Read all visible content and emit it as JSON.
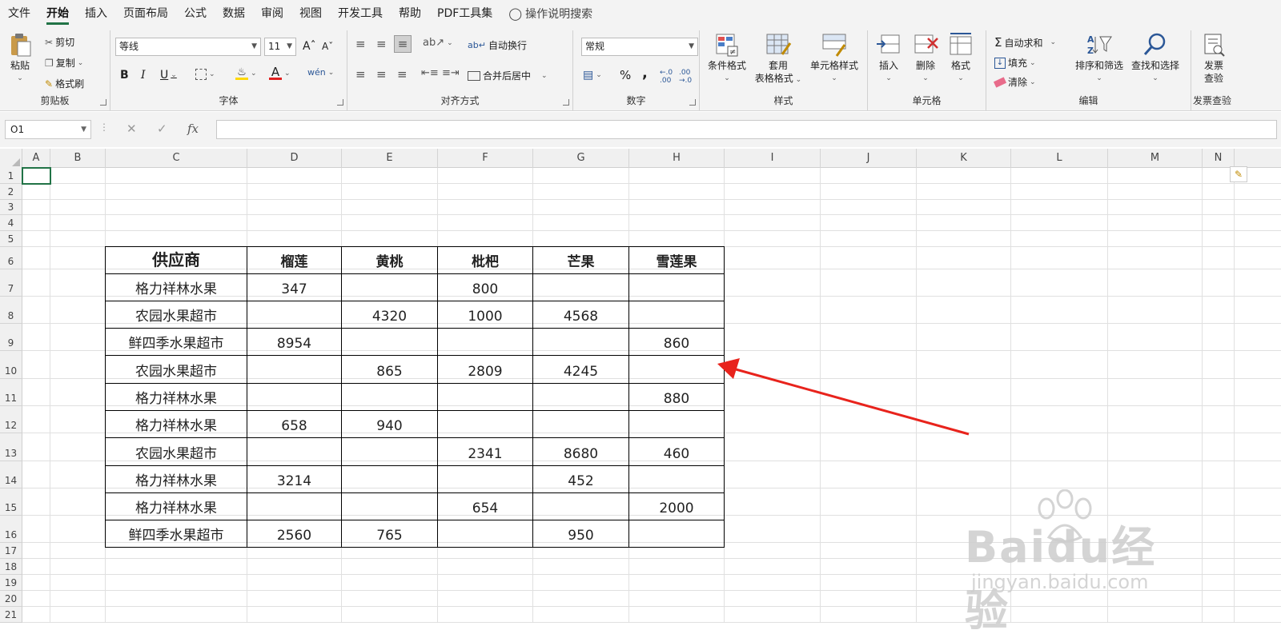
{
  "menu": {
    "items": [
      "文件",
      "开始",
      "插入",
      "页面布局",
      "公式",
      "数据",
      "审阅",
      "视图",
      "开发工具",
      "帮助",
      "PDF工具集"
    ],
    "active_index": 1,
    "search_label": "操作说明搜索"
  },
  "ribbon": {
    "clipboard": {
      "paste": "粘贴",
      "cut": "剪切",
      "copy": "复制",
      "format_painter": "格式刷",
      "label": "剪贴板"
    },
    "font": {
      "font_name": "等线",
      "font_size": "11",
      "bold": "B",
      "italic": "I",
      "underline": "U",
      "label": "字体"
    },
    "alignment": {
      "wrap_text": "自动换行",
      "merge_center": "合并后居中",
      "label": "对齐方式"
    },
    "number": {
      "format": "常规",
      "percent": "%",
      "comma": ",",
      "label": "数字"
    },
    "styles": {
      "conditional": "条件格式",
      "table_format_1": "套用",
      "table_format_2": "表格格式",
      "cell_styles": "单元格样式",
      "label": "样式"
    },
    "cells": {
      "insert": "插入",
      "delete": "删除",
      "format": "格式",
      "label": "单元格"
    },
    "editing": {
      "autosum": "自动求和",
      "fill": "填充",
      "clear": "清除",
      "sort_filter": "排序和筛选",
      "find_select": "查找和选择",
      "label": "编辑"
    },
    "invoice": {
      "check_1": "发票",
      "check_2": "查验",
      "label": "发票查验"
    }
  },
  "formula_bar": {
    "name_box": "O1",
    "fx": "fx",
    "value": ""
  },
  "columns": [
    "A",
    "B",
    "C",
    "D",
    "E",
    "F",
    "G",
    "H",
    "I",
    "J",
    "K",
    "L",
    "M",
    "N"
  ],
  "rows": [
    "1",
    "2",
    "3",
    "4",
    "5",
    "6",
    "7",
    "8",
    "9",
    "10",
    "11",
    "12",
    "13",
    "14",
    "15",
    "16",
    "17",
    "18",
    "19",
    "20",
    "21"
  ],
  "table": {
    "headers": [
      "供应商",
      "榴莲",
      "黄桃",
      "枇杷",
      "芒果",
      "雪莲果"
    ],
    "rows": [
      [
        "格力祥林水果",
        "347",
        "",
        "800",
        "",
        ""
      ],
      [
        "农园水果超市",
        "",
        "4320",
        "1000",
        "4568",
        ""
      ],
      [
        "鲜四季水果超市",
        "8954",
        "",
        "",
        "",
        "860"
      ],
      [
        "农园水果超市",
        "",
        "865",
        "2809",
        "4245",
        ""
      ],
      [
        "格力祥林水果",
        "",
        "",
        "",
        "",
        "880"
      ],
      [
        "格力祥林水果",
        "658",
        "940",
        "",
        "",
        ""
      ],
      [
        "农园水果超市",
        "",
        "",
        "2341",
        "8680",
        "460"
      ],
      [
        "格力祥林水果",
        "3214",
        "",
        "",
        "452",
        ""
      ],
      [
        "格力祥林水果",
        "",
        "",
        "654",
        "",
        "2000"
      ],
      [
        "鲜四季水果超市",
        "2560",
        "765",
        "",
        "950",
        ""
      ]
    ]
  },
  "colors": {
    "accent": "#217346",
    "arrow": "#e8231c",
    "font_red": "#e02020"
  },
  "watermark": {
    "brand": "Baidu经验",
    "url": "jingyan.baidu.com"
  }
}
